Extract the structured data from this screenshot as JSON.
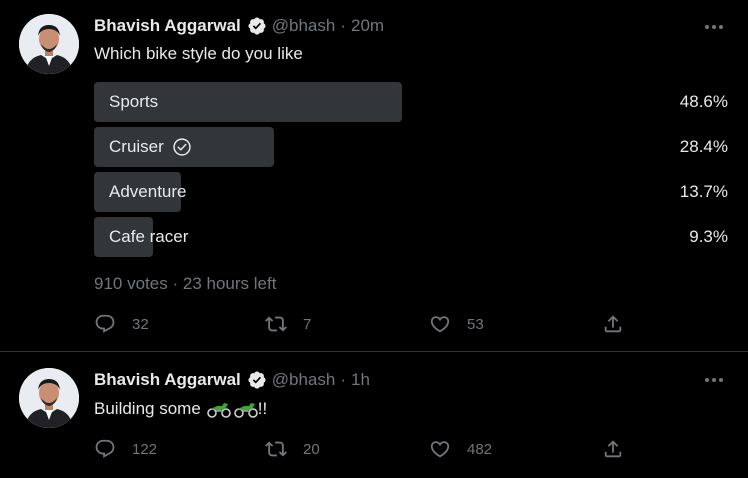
{
  "tweets": [
    {
      "author": {
        "name": "Bhavish Aggarwal",
        "handle": "@bhash",
        "separator": "·",
        "time": "20m"
      },
      "text": "Which bike style do you like",
      "poll": {
        "options": [
          {
            "label": "Sports",
            "percent": "48.6%",
            "fraction": 0.486,
            "selected": false
          },
          {
            "label": "Cruiser",
            "percent": "28.4%",
            "fraction": 0.284,
            "selected": true
          },
          {
            "label": "Adventure",
            "percent": "13.7%",
            "fraction": 0.137,
            "selected": false
          },
          {
            "label": "Cafe racer",
            "percent": "9.3%",
            "fraction": 0.093,
            "selected": false
          }
        ],
        "votes": "910 votes",
        "separator": "·",
        "time_left": "23 hours left"
      },
      "actions": {
        "replies": "32",
        "retweets": "7",
        "likes": "53"
      }
    },
    {
      "author": {
        "name": "Bhavish Aggarwal",
        "handle": "@bhash",
        "separator": "·",
        "time": "1h"
      },
      "text": "Building some",
      "text_suffix": "!!",
      "emojis": [
        "motorcycle-emoji",
        "motorcycle-emoji"
      ],
      "actions": {
        "replies": "122",
        "retweets": "20",
        "likes": "482"
      }
    }
  ],
  "colors": {
    "background": "#000000",
    "text": "#e7e9ea",
    "muted": "#71767b",
    "poll_bar": "#333639",
    "divider": "#2f3336",
    "verified_badge": "#e7e9ea",
    "bike_green": "#3fa535"
  },
  "icons": {
    "verified": "verified-badge-icon",
    "more": "more-dots-icon",
    "reply": "reply-icon",
    "retweet": "retweet-icon",
    "like": "heart-icon",
    "share": "share-icon",
    "poll_selected": "check-circle-icon"
  }
}
